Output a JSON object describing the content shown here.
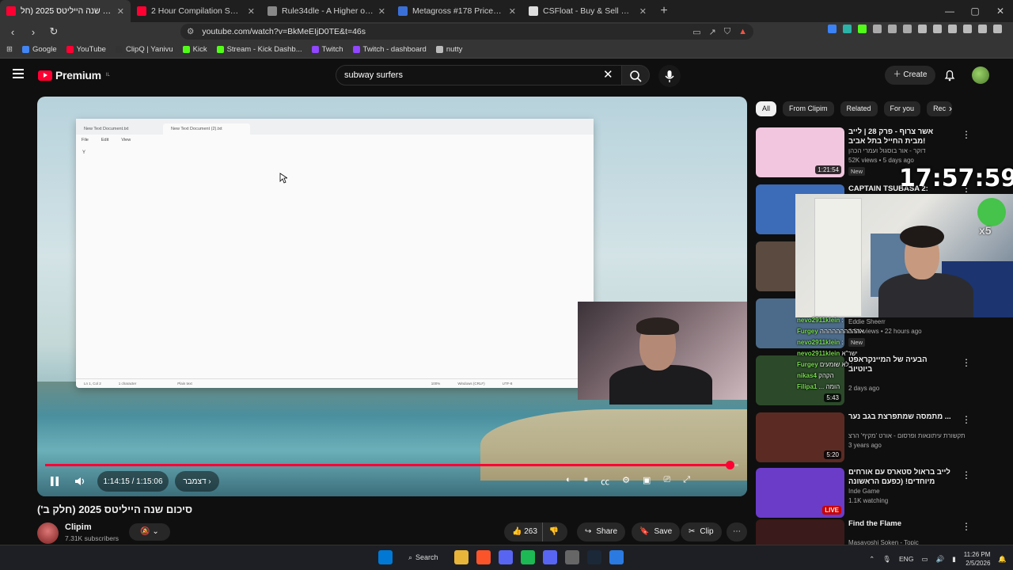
{
  "tabs": [
    {
      "label": "סיכום שנה הייליטס 2025 (חל",
      "color": "#ff0033",
      "active": true
    },
    {
      "label": "2 Hour Compilation Subway Surfers",
      "color": "#ff0033"
    },
    {
      "label": "Rule34dle - A Higher or Lower G",
      "color": "#888888"
    },
    {
      "label": "Metagross #178 Prices | Pokemon Ta",
      "color": "#3b6fd8"
    },
    {
      "label": "CSFloat - Buy & Sell CS2 Skins on th",
      "color": "#dddddd"
    }
  ],
  "address": {
    "url": "youtube.com/watch?v=BkMeEIjD0TE&t=46s"
  },
  "bookmarks": [
    {
      "label": "Google",
      "color": "#4285f4"
    },
    {
      "label": "YouTube",
      "color": "#ff0033"
    },
    {
      "label": "ClipQ | Yanivu",
      "color": "#333333"
    },
    {
      "label": "Kick",
      "color": "#53fc18"
    },
    {
      "label": "Stream - Kick Dashb...",
      "color": "#53fc18"
    },
    {
      "label": "Twitch",
      "color": "#9146ff"
    },
    {
      "label": "Twitch - dashboard",
      "color": "#9146ff"
    },
    {
      "label": "nutty",
      "color": "#bbbbbb"
    }
  ],
  "header": {
    "logo_word": "Premium",
    "logo_region": "IL",
    "search_value": "subway surfers",
    "create_label": "Create"
  },
  "player": {
    "notepad_tab1": "New Text Document.txt",
    "notepad_tab2": "New Text Document (2).txt",
    "menu_file": "File",
    "menu_edit": "Edit",
    "menu_view": "View",
    "typed": "Y",
    "status_pos": "Ln 1, Col 2",
    "status_chars": "1 character",
    "status_type": "Plain text",
    "status_zoom": "100%",
    "status_eol": "Windows (CRLF)",
    "status_enc": "UTF-8",
    "time_text": "1:14:15 / 1:15:06",
    "chapter_label": "דצמבר",
    "progress_fraction": 0.988
  },
  "video": {
    "title": "סיכום שנה הייליטס 2025 (חלק ב')",
    "channel": "Clipim",
    "subscribers": "7.31K subscribers",
    "likes": "263",
    "share": "Share",
    "save": "Save",
    "clip": "Clip"
  },
  "chips": [
    "All",
    "From Clipim",
    "Related",
    "For you",
    "Rec"
  ],
  "recommendations": [
    {
      "title": "אשר צרוף - פרק 28 | לייב מבית החייל בתל אביב!",
      "channel": "דוקר - אור בוסגול ועמרי הכהן",
      "meta": "52K views • 5 days ago",
      "badge": "New",
      "duration": "1:21:54",
      "thumb": "#f1c6de"
    },
    {
      "title": "CAPTAIN TSUBASA 2: WORLD",
      "channel": "",
      "meta": "",
      "badge": "",
      "duration": "",
      "thumb": "#3c6bb8"
    },
    {
      "title": "",
      "channel": "",
      "meta": "",
      "badge": "",
      "duration": "",
      "thumb": "#5a4a40"
    },
    {
      "title": "",
      "channel": "Eddie Sheerr",
      "meta": "3.5K views • 22 hours ago",
      "badge": "New",
      "duration": "",
      "thumb": "#4c6b8a"
    },
    {
      "title": "הבעיה של המיינקראפט ביוטיוב",
      "channel": "",
      "meta": "2 days ago",
      "badge": "",
      "duration": "5:43",
      "thumb": "#2c4a2a"
    },
    {
      "title": "מתמסה שמתפרצת בגב נער ...",
      "channel": "תקשורת עיתונאות ופרסום - אורט 'מקיף' הרצ",
      "meta": "3 years ago",
      "badge": "",
      "duration": "5:20",
      "thumb": "#5b2b23"
    },
    {
      "title": "לייב בראול סטארס עם אורחים מיוחדים! (כפעם הראשונה עושים",
      "channel": "Inde Game",
      "meta": "1.1K watching",
      "badge": "",
      "duration": "LIVE",
      "thumb": "#6a3cc8"
    },
    {
      "title": "Find the Flame",
      "channel": "Masayoshi Soken - Topic",
      "meta": "",
      "badge": "",
      "duration": "",
      "thumb": "#3a1a1a"
    }
  ],
  "overlay": {
    "clock": "17:57:59",
    "emote_count": "x5",
    "chat": [
      {
        "user": "nevo2911klein",
        "msg": ":"
      },
      {
        "user": "Furgey",
        "msg": "אהההההההההה"
      },
      {
        "user": "nevo2911klein",
        "msg": ":"
      },
      {
        "user": "nevo2911klein",
        "msg": "ישר\"א"
      },
      {
        "user": "Furgey",
        "msg": "לא שומעים :"
      },
      {
        "user": "nikas4",
        "msg": "הקהק"
      },
      {
        "user": "Filipa1",
        "msg": "... הומה"
      }
    ]
  },
  "taskbar": {
    "search_label": "Search",
    "lang": "ENG",
    "time": "11:26 PM",
    "date": "2/5/2026",
    "icons": [
      "#0078d4",
      "#333333",
      "#e8b43a",
      "#fb542b",
      "#5865f2",
      "#1db954",
      "#5865f2",
      "#666666",
      "#1b2838",
      "#2a7ae2"
    ]
  }
}
